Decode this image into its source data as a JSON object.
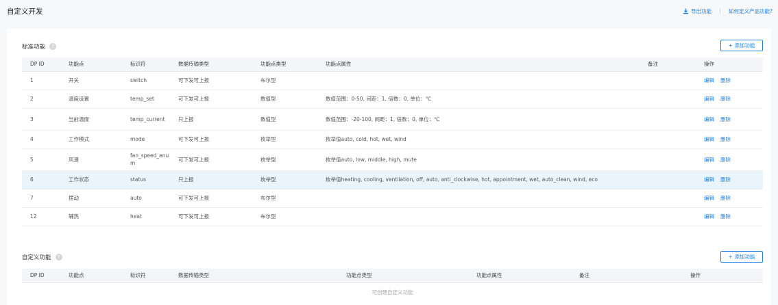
{
  "page": {
    "title": "自定义开发"
  },
  "top_actions": {
    "export_label": "导出功能",
    "help_label": "如何定义产品功能?"
  },
  "standard": {
    "title": "标准功能",
    "add_label": "+ 添加功能",
    "columns": [
      "DP ID",
      "功能点",
      "标识符",
      "数据传输类型",
      "功能点类型",
      "功能点属性",
      "备注",
      "操作"
    ],
    "rows": [
      {
        "id": "1",
        "name": "开关",
        "ident": "switch",
        "trans": "可下发可上报",
        "type": "布尔型",
        "attr": "",
        "note": "",
        "edit": "编辑",
        "del": "删除"
      },
      {
        "id": "2",
        "name": "温度设置",
        "ident": "temp_set",
        "trans": "可下发可上报",
        "type": "数值型",
        "attr": "数值范围：0-50, 间距：1, 倍数：0, 单位：℃",
        "note": "",
        "edit": "编辑",
        "del": "删除"
      },
      {
        "id": "3",
        "name": "当前温度",
        "ident": "temp_current",
        "trans": "只上报",
        "type": "数值型",
        "attr": "数值范围：-20-100, 间距：1, 倍数：0, 单位：℃",
        "note": "",
        "edit": "编辑",
        "del": "删除"
      },
      {
        "id": "4",
        "name": "工作模式",
        "ident": "mode",
        "trans": "可下发可上报",
        "type": "枚举型",
        "attr": "枚举值auto, cold, hot, wet, wind",
        "note": "",
        "edit": "编辑",
        "del": "删除"
      },
      {
        "id": "5",
        "name": "风速",
        "ident": "fan_speed_enum",
        "trans": "可下发可上报",
        "type": "枚举型",
        "attr": "枚举值auto, low, middle, high, mute",
        "note": "",
        "edit": "编辑",
        "del": "删除"
      },
      {
        "id": "6",
        "name": "工作状态",
        "ident": "status",
        "trans": "只上报",
        "type": "枚举型",
        "attr": "枚举值heating, cooling, ventilation, off, auto, anti_clockwise, hot, appointment, wet, auto_clean, wind, eco",
        "note": "",
        "edit": "编辑",
        "del": "删除"
      },
      {
        "id": "7",
        "name": "摆动",
        "ident": "auto",
        "trans": "可下发可上报",
        "type": "布尔型",
        "attr": "",
        "note": "",
        "edit": "编辑",
        "del": "删除"
      },
      {
        "id": "12",
        "name": "辅热",
        "ident": "heat",
        "trans": "可下发可上报",
        "type": "布尔型",
        "attr": "",
        "note": "",
        "edit": "编辑",
        "del": "删除"
      }
    ]
  },
  "custom": {
    "title": "自定义功能",
    "add_label": "+ 添加功能",
    "columns": [
      "DP ID",
      "功能点",
      "标识符",
      "数据传输类型",
      "功能点类型",
      "功能点属性",
      "备注",
      "操作"
    ],
    "empty_text": "可创建自定义功能"
  },
  "colors": {
    "accent": "#1e82e6",
    "highlight_row": "#e9f4fd"
  }
}
